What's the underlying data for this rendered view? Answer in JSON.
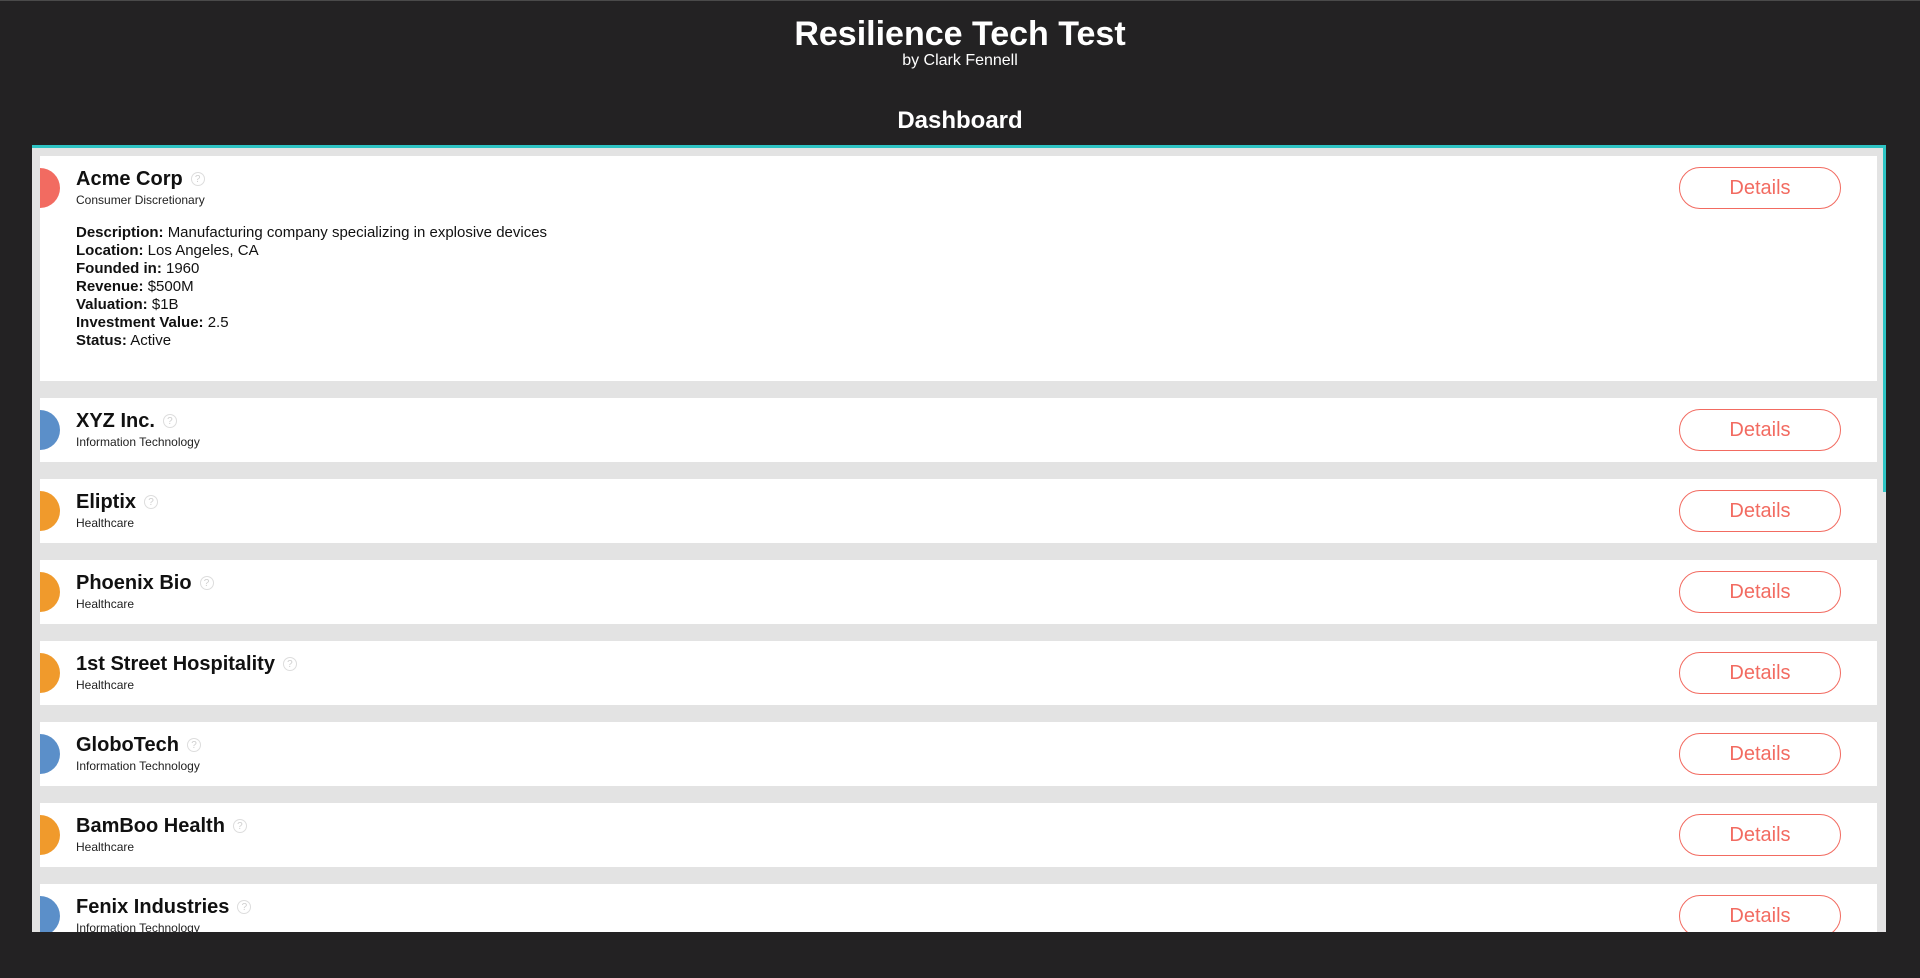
{
  "app": {
    "title": "Resilience Tech Test",
    "byline": "by Clark Fennell",
    "section_title": "Dashboard"
  },
  "colors": {
    "accent": "#2ec4c4",
    "button": "#f26b61",
    "dot_red": "#f26b61",
    "dot_blue": "#5b8fc9",
    "dot_orange": "#f09a2c"
  },
  "companies": [
    {
      "name": "Acme Corp",
      "sector": "Consumer Discretionary",
      "dot_color": "#f26b61",
      "button_label": "Details",
      "expanded": true,
      "info": [
        {
          "label": "Description:",
          "value": "Manufacturing company specializing in explosive devices"
        },
        {
          "label": "Location:",
          "value": "Los Angeles, CA"
        },
        {
          "label": "Founded in:",
          "value": "1960"
        },
        {
          "label": "Revenue:",
          "value": "$500M"
        },
        {
          "label": "Valuation:",
          "value": "$1B"
        },
        {
          "label": "Investment Value:",
          "value": "2.5"
        },
        {
          "label": "Status:",
          "value": "Active"
        }
      ]
    },
    {
      "name": "XYZ Inc.",
      "sector": "Information Technology",
      "dot_color": "#5b8fc9",
      "button_label": "Details"
    },
    {
      "name": "Eliptix",
      "sector": "Healthcare",
      "dot_color": "#f09a2c",
      "button_label": "Details"
    },
    {
      "name": "Phoenix Bio",
      "sector": "Healthcare",
      "dot_color": "#f09a2c",
      "button_label": "Details"
    },
    {
      "name": "1st Street Hospitality",
      "sector": "Healthcare",
      "dot_color": "#f09a2c",
      "button_label": "Details"
    },
    {
      "name": "GloboTech",
      "sector": "Information Technology",
      "dot_color": "#5b8fc9",
      "button_label": "Details"
    },
    {
      "name": "BamBoo Health",
      "sector": "Healthcare",
      "dot_color": "#f09a2c",
      "button_label": "Details"
    },
    {
      "name": "Fenix Industries",
      "sector": "Information Technology",
      "dot_color": "#5b8fc9",
      "button_label": "Details"
    }
  ]
}
